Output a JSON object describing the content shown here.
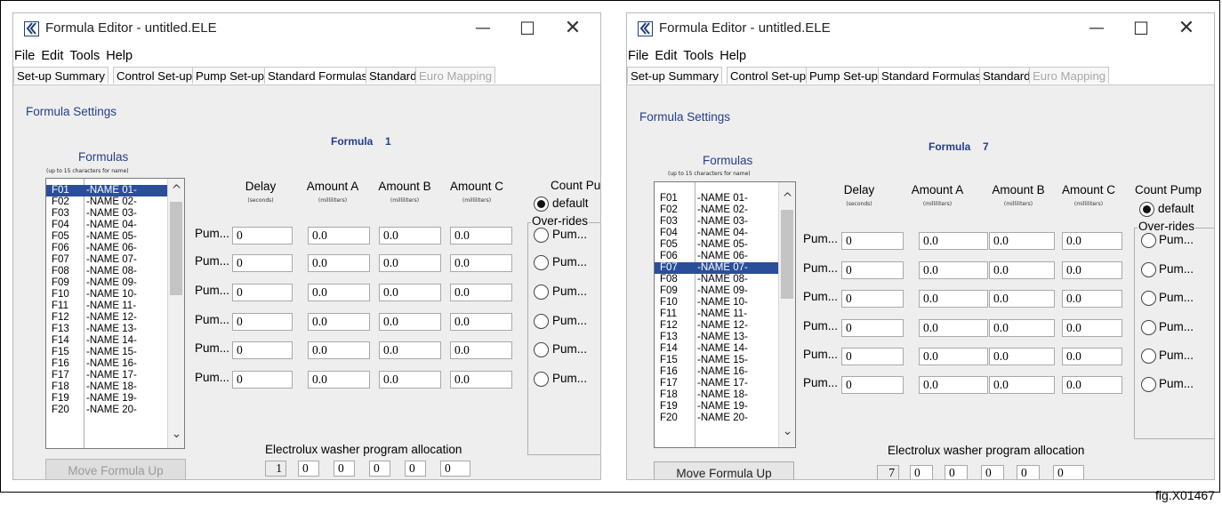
{
  "windows": [
    {
      "title": "Formula Editor - untitled.ELE",
      "menu": [
        "File",
        "Edit",
        "Tools",
        "Help"
      ],
      "tabs": [
        "Set-up Summary",
        "Control Set-up",
        "Pump Set-up",
        "Standard Formulas",
        "Standard",
        "Euro Mapping"
      ],
      "section_title": "Formula Settings",
      "formula_label": "Formula",
      "formula_number": "1",
      "formulas_heading": "Formulas",
      "formulas_subheading": "(up to 15 characters for name)",
      "formula_list": [
        {
          "code": "F01",
          "name": "-NAME 01-"
        },
        {
          "code": "F02",
          "name": "-NAME 02-"
        },
        {
          "code": "F03",
          "name": "-NAME 03-"
        },
        {
          "code": "F04",
          "name": "-NAME 04-"
        },
        {
          "code": "F05",
          "name": "-NAME 05-"
        },
        {
          "code": "F06",
          "name": "-NAME 06-"
        },
        {
          "code": "F07",
          "name": "-NAME 07-"
        },
        {
          "code": "F08",
          "name": "-NAME 08-"
        },
        {
          "code": "F09",
          "name": "-NAME 09-"
        },
        {
          "code": "F10",
          "name": "-NAME 10-"
        },
        {
          "code": "F11",
          "name": "-NAME 11-"
        },
        {
          "code": "F12",
          "name": "-NAME 12-"
        },
        {
          "code": "F13",
          "name": "-NAME 13-"
        },
        {
          "code": "F14",
          "name": "-NAME 14-"
        },
        {
          "code": "F15",
          "name": "-NAME 15-"
        },
        {
          "code": "F16",
          "name": "-NAME 16-"
        },
        {
          "code": "F17",
          "name": "-NAME 17-"
        },
        {
          "code": "F18",
          "name": "-NAME 18-"
        },
        {
          "code": "F19",
          "name": "-NAME 19-"
        },
        {
          "code": "F20",
          "name": "-NAME 20-"
        }
      ],
      "move_button": "Move Formula Up",
      "columns": {
        "delay": "Delay",
        "delay_unit": "(seconds)",
        "amount_a": "Amount A",
        "amount_a_unit": "(milliliters)",
        "amount_b": "Amount B",
        "amount_b_unit": "(milliliters)",
        "amount_c": "Amount C",
        "amount_c_unit": "(milliliters)"
      },
      "pump_rows": [
        {
          "label": "Pum...",
          "delay": "0",
          "a": "0.0",
          "b": "0.0",
          "c": "0.0"
        },
        {
          "label": "Pum...",
          "delay": "0",
          "a": "0.0",
          "b": "0.0",
          "c": "0.0"
        },
        {
          "label": "Pum...",
          "delay": "0",
          "a": "0.0",
          "b": "0.0",
          "c": "0.0"
        },
        {
          "label": "Pum...",
          "delay": "0",
          "a": "0.0",
          "b": "0.0",
          "c": "0.0"
        },
        {
          "label": "Pum...",
          "delay": "0",
          "a": "0.0",
          "b": "0.0",
          "c": "0.0"
        },
        {
          "label": "Pum...",
          "delay": "0",
          "a": "0.0",
          "b": "0.0",
          "c": "0.0"
        }
      ],
      "count_pump": {
        "heading": "Count Pump",
        "default_label": "default",
        "overrides_label": "Over-rides",
        "override_options": [
          "Pum...",
          "Pum...",
          "Pum...",
          "Pum...",
          "Pum...",
          "Pum..."
        ]
      },
      "allocation": {
        "title": "Electrolux washer program allocation",
        "values": [
          "1",
          "0",
          "0",
          "0",
          "0",
          "0"
        ]
      }
    },
    {
      "title": "Formula Editor - untitled.ELE",
      "menu": [
        "File",
        "Edit",
        "Tools",
        "Help"
      ],
      "tabs": [
        "Set-up Summary",
        "Control Set-up",
        "Pump Set-up",
        "Standard Formulas",
        "Standard",
        "Euro Mapping"
      ],
      "section_title": "Formula Settings",
      "formula_label": "Formula",
      "formula_number": "7",
      "formulas_heading": "Formulas",
      "formulas_subheading": "(up to 15 characters for name)",
      "formula_list": [
        {
          "code": "F01",
          "name": "-NAME 01-"
        },
        {
          "code": "F02",
          "name": "-NAME 02-"
        },
        {
          "code": "F03",
          "name": "-NAME 03-"
        },
        {
          "code": "F04",
          "name": "-NAME 04-"
        },
        {
          "code": "F05",
          "name": "-NAME 05-"
        },
        {
          "code": "F06",
          "name": "-NAME 06-"
        },
        {
          "code": "F07",
          "name": "-NAME 07-"
        },
        {
          "code": "F08",
          "name": "-NAME 08-"
        },
        {
          "code": "F09",
          "name": "-NAME 09-"
        },
        {
          "code": "F10",
          "name": "-NAME 10-"
        },
        {
          "code": "F11",
          "name": "-NAME 11-"
        },
        {
          "code": "F12",
          "name": "-NAME 12-"
        },
        {
          "code": "F13",
          "name": "-NAME 13-"
        },
        {
          "code": "F14",
          "name": "-NAME 14-"
        },
        {
          "code": "F15",
          "name": "-NAME 15-"
        },
        {
          "code": "F16",
          "name": "-NAME 16-"
        },
        {
          "code": "F17",
          "name": "-NAME 17-"
        },
        {
          "code": "F18",
          "name": "-NAME 18-"
        },
        {
          "code": "F19",
          "name": "-NAME 19-"
        },
        {
          "code": "F20",
          "name": "-NAME 20-"
        }
      ],
      "move_button": "Move Formula Up",
      "columns": {
        "delay": "Delay",
        "delay_unit": "(seconds)",
        "amount_a": "Amount A",
        "amount_a_unit": "(milliliters)",
        "amount_b": "Amount B",
        "amount_b_unit": "(milliliters)",
        "amount_c": "Amount C",
        "amount_c_unit": "(milliliters)"
      },
      "pump_rows": [
        {
          "label": "Pum...",
          "delay": "0",
          "a": "0.0",
          "b": "0.0",
          "c": "0.0"
        },
        {
          "label": "Pum...",
          "delay": "0",
          "a": "0.0",
          "b": "0.0",
          "c": "0.0"
        },
        {
          "label": "Pum...",
          "delay": "0",
          "a": "0.0",
          "b": "0.0",
          "c": "0.0"
        },
        {
          "label": "Pum...",
          "delay": "0",
          "a": "0.0",
          "b": "0.0",
          "c": "0.0"
        },
        {
          "label": "Pum...",
          "delay": "0",
          "a": "0.0",
          "b": "0.0",
          "c": "0.0"
        },
        {
          "label": "Pum...",
          "delay": "0",
          "a": "0.0",
          "b": "0.0",
          "c": "0.0"
        }
      ],
      "count_pump": {
        "heading": "Count Pump",
        "default_label": "default",
        "overrides_label": "Over-rides",
        "override_options": [
          "Pum...",
          "Pum...",
          "Pum...",
          "Pum...",
          "Pum...",
          "Pum..."
        ]
      },
      "allocation": {
        "title": "Electrolux washer program allocation",
        "values": [
          "7",
          "0",
          "0",
          "0",
          "0",
          "0"
        ]
      }
    }
  ],
  "figure_label": "fig.X01467"
}
